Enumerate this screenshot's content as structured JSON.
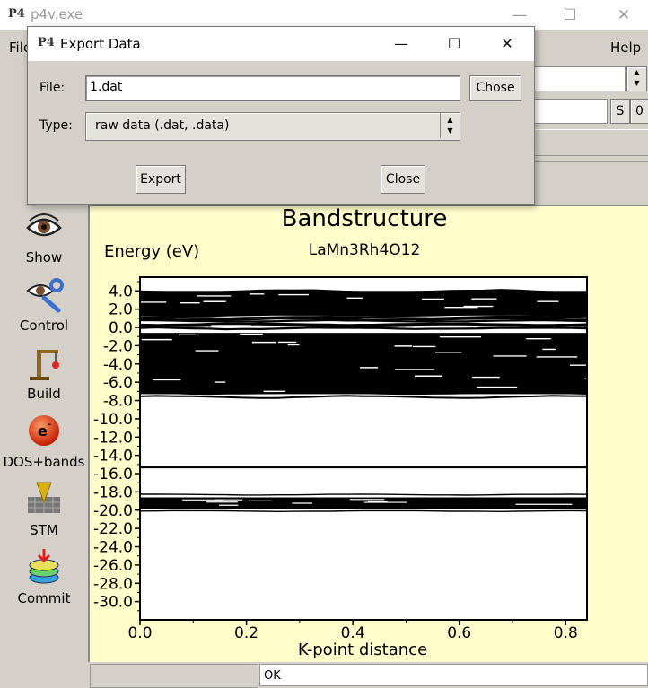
{
  "main_window": {
    "title": "p4v.exe",
    "logo": "P4",
    "controls": {
      "minimize": "—",
      "maximize": "☐",
      "close": "✕"
    },
    "menu": {
      "file": "File",
      "help": "Help"
    },
    "toolbar": {
      "s_button": "S",
      "o_button": "0",
      "spin_up": "▲",
      "spin_down": "▼"
    }
  },
  "sidebar": {
    "items": [
      {
        "label": "Show",
        "icon": "eye-icon"
      },
      {
        "label": "Control",
        "icon": "eye-wrench-icon"
      },
      {
        "label": "Build",
        "icon": "crane-icon"
      },
      {
        "label": "DOS+bands",
        "icon": "electron-icon"
      },
      {
        "label": "STM",
        "icon": "stm-tip-icon"
      },
      {
        "label": "Commit",
        "icon": "commit-stack-icon"
      }
    ]
  },
  "status": {
    "message": "OK"
  },
  "dialog": {
    "title": "Export Data",
    "logo": "P4",
    "controls": {
      "minimize": "—",
      "maximize": "☐",
      "close": "✕"
    },
    "file_label": "File:",
    "file_value": "1.dat",
    "chose_button": "Chose",
    "type_label": "Type:",
    "type_value": "raw data (.dat, .data)",
    "export_button": "Export",
    "close_button": "Close"
  },
  "chart_data": {
    "type": "line",
    "title": "Bandstructure",
    "subtitle": "LaMn3Rh4O12",
    "ylabel": "Energy (eV)",
    "xlabel": "K-point distance",
    "xlim": [
      0.0,
      0.84
    ],
    "ylim": [
      -32.0,
      5.5
    ],
    "xticks": [
      "0.0",
      "0.2",
      "0.4",
      "0.6",
      "0.8"
    ],
    "yticks": [
      "4.0",
      "2.0",
      "0.0",
      "-2.0",
      "-4.0",
      "-6.0",
      "-8.0",
      "-10.0",
      "-12.0",
      "-14.0",
      "-16.0",
      "-18.0",
      "-20.0",
      "-22.0",
      "-24.0",
      "-26.0",
      "-28.0",
      "-30.0"
    ],
    "band_regions": [
      {
        "emin": -7.5,
        "emax": 4.0,
        "description": "dense valence/conduction bands"
      },
      {
        "emin": -20.0,
        "emax": -18.5,
        "description": "semicore bands"
      },
      {
        "emin": -15.3,
        "emax": -15.3,
        "description": "flat band"
      }
    ]
  }
}
